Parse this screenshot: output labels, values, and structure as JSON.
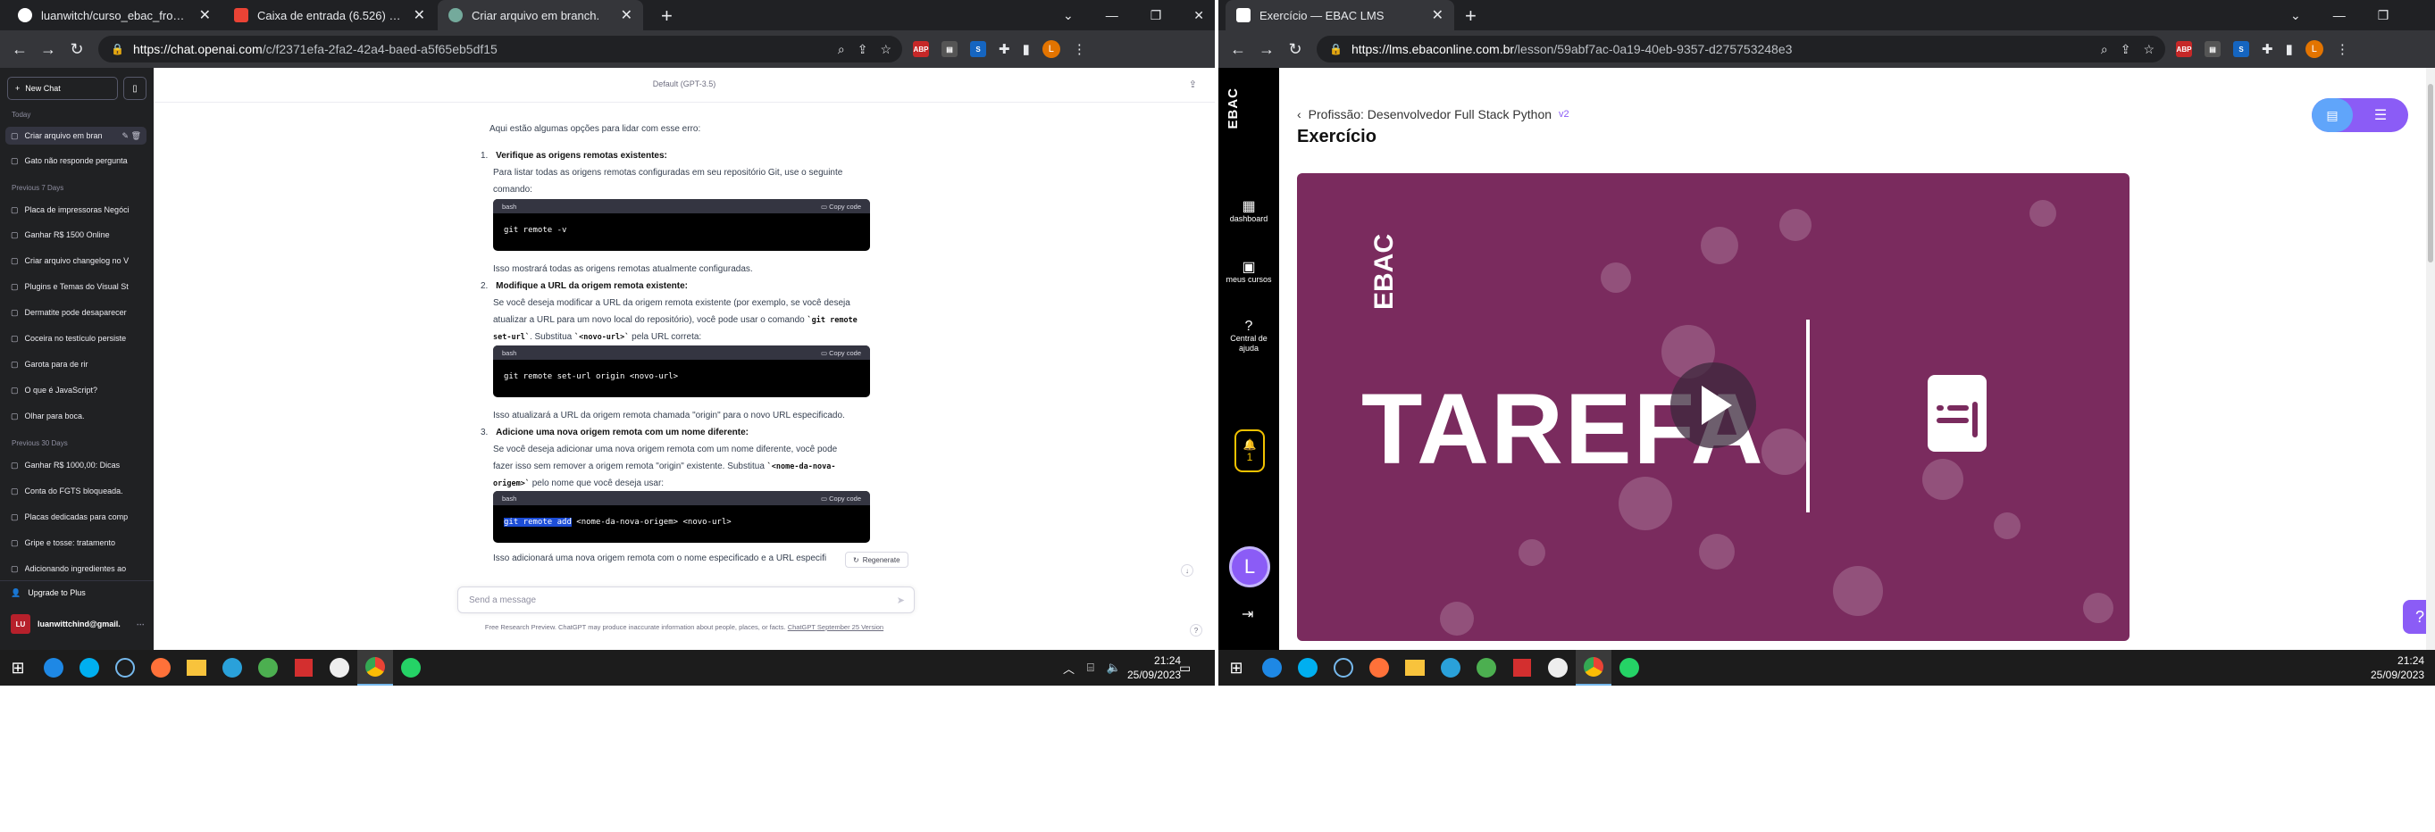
{
  "left": {
    "tabs": [
      {
        "title": "luanwitch/curso_ebac_frontend",
        "favicon_color": "#ffffff"
      },
      {
        "title": "Caixa de entrada (6.526) - luanw",
        "favicon_color": "#ea4335"
      },
      {
        "title": "Criar arquivo em branch.",
        "favicon_color": "#74aa9c"
      }
    ],
    "url": {
      "host": "https://chat.openai.com",
      "path": "/c/f2371efa-2fa2-42a4-baed-a5f65eb5df15"
    },
    "sidebar": {
      "new_chat": "New Chat",
      "sections": [
        {
          "label": "Today",
          "items": [
            "Criar arquivo em bran",
            "Gato não responde pergunta"
          ]
        },
        {
          "label": "Previous 7 Days",
          "items": [
            "Placa de impressoras Negóci",
            "Ganhar R$ 1500 Online",
            "Criar arquivo changelog no V",
            "Plugins e Temas do Visual St",
            "Dermatite pode desaparecer",
            "Coceira no testículo persiste",
            "Garota para de rir",
            "O que é JavaScript?",
            "Olhar para boca."
          ]
        },
        {
          "label": "Previous 30 Days",
          "items": [
            "Ganhar R$ 1000,00: Dicas",
            "Conta do FGTS bloqueada.",
            "Placas dedicadas para comp",
            "Gripe e tosse: tratamento",
            "Adicionando ingredientes ao"
          ]
        }
      ],
      "upgrade": "Upgrade to Plus",
      "user_initials": "LU",
      "user_email": "luanwittchind@gmail."
    },
    "chat": {
      "model": "Default (GPT-3.5)",
      "intro": "Aqui estão algumas opções para lidar com esse erro:",
      "steps": [
        {
          "num": "1.",
          "heading": "Verifique as origens remotas existentes:",
          "text_before": "Para listar todas as origens remotas configuradas em seu repositório Git, use o seguinte",
          "text_before2": "comando:",
          "lang": "bash",
          "code": "git remote -v",
          "text_after": "Isso mostrará todas as origens remotas atualmente configuradas."
        },
        {
          "num": "2.",
          "heading": "Modifique a URL da origem remota existente:",
          "text_before": "Se você deseja modificar a URL da origem remota existente (por exemplo, se você deseja",
          "text_before2a": "atualizar a URL para um novo local do repositório), você pode usar o comando ",
          "code_inline_a": "`git remote",
          "code_inline_b": "set-url`",
          "text_before3a": ". Substitua ",
          "code_inline_c": "`<novo-url>`",
          "text_before3b": " pela URL correta:",
          "lang": "bash",
          "code": "git remote set-url origin <novo-url>",
          "text_after": "Isso atualizará a URL da origem remota chamada \"origin\" para o novo URL especificado."
        },
        {
          "num": "3.",
          "heading": "Adicione uma nova origem remota com um nome diferente:",
          "text_before": "Se você deseja adicionar uma nova origem remota com um nome diferente, você pode",
          "text_before2a": "fazer isso sem remover a origem remota \"origin\" existente. Substitua ",
          "code_inline_a": "`<nome-da-nova-",
          "code_inline_b": "origem>`",
          "text_before3a": " pelo nome que você deseja usar:",
          "lang": "bash",
          "code_selected": "git remote add",
          "code": " <nome-da-nova-origem> <novo-url>",
          "text_after": "Isso adicionará uma nova origem remota com o nome especificado e a URL especifi"
        }
      ],
      "copy_label": "Copy code",
      "regenerate": "Regenerate",
      "placeholder": "Send a message",
      "disclaimer": "Free Research Preview. ChatGPT may produce inaccurate information about people, places, or facts.",
      "disclaimer_link": "ChatGPT September 25 Version"
    },
    "clock": {
      "time": "21:24",
      "date": "25/09/2023"
    }
  },
  "right": {
    "tab": {
      "title": "Exercício — EBAC LMS"
    },
    "url": {
      "host": "https://lms.ebaconline.com.br",
      "path": "/lesson/59abf7ac-0a19-40eb-9357-d275753248e3"
    },
    "rail": {
      "logo": "EBAC",
      "items": [
        "dashboard",
        "meus cursos",
        "Central de ajuda"
      ],
      "bell_count": "1",
      "user_initial": "L"
    },
    "breadcrumb": "Profissão: Desenvolvedor Full Stack Python",
    "version": "v2",
    "title": "Exercício",
    "video": {
      "logo": "EBAC",
      "word": "TAREFA"
    },
    "clock": {
      "time": "21:24",
      "date": "25/09/2023"
    }
  },
  "colors": {
    "ebac_purple": "#8b5cf6",
    "video_bg": "#7a2b5e",
    "chatgpt_sidebar": "#202123"
  }
}
